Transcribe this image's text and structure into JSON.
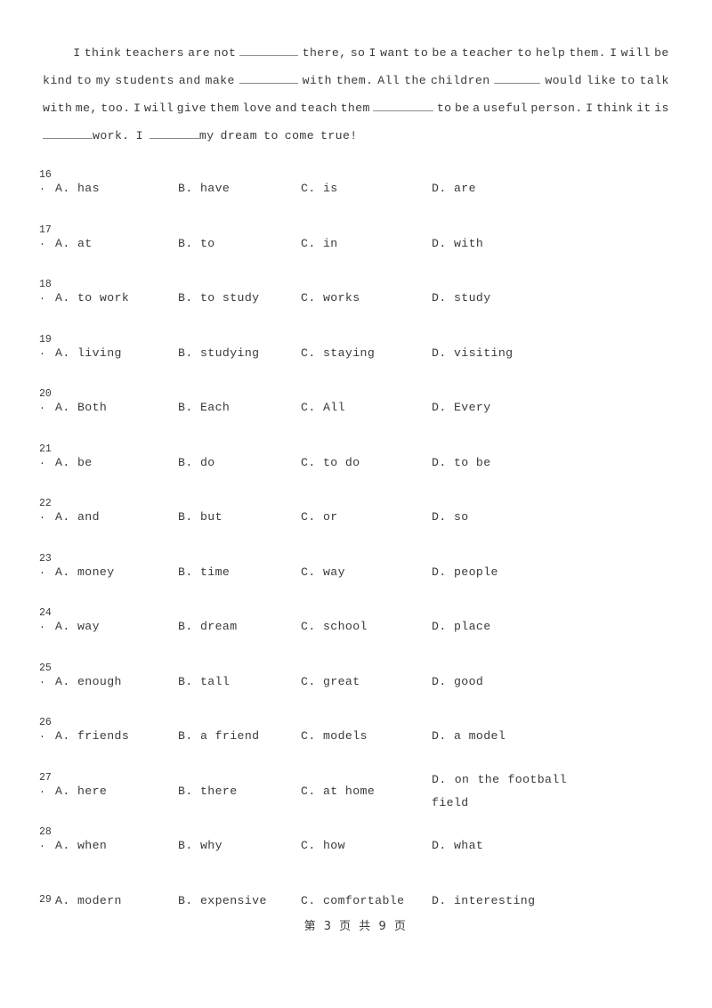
{
  "document": {
    "type": "cloze-test-worksheet",
    "footer": "第 3 页 共 9 页"
  },
  "passage": {
    "lines": [
      {
        "justify": true,
        "tokens": [
          {
            "type": "indent"
          },
          {
            "type": "text",
            "text": "I"
          },
          {
            "type": "text",
            "text": "think"
          },
          {
            "type": "text",
            "text": "teachers"
          },
          {
            "type": "text",
            "text": "are"
          },
          {
            "type": "text",
            "text": "not"
          },
          {
            "type": "blank",
            "size": "b1"
          },
          {
            "type": "text",
            "text": "there,"
          },
          {
            "type": "text",
            "text": "so"
          },
          {
            "type": "text",
            "text": "I"
          },
          {
            "type": "text",
            "text": "want"
          },
          {
            "type": "text",
            "text": "to"
          },
          {
            "type": "text",
            "text": "be"
          },
          {
            "type": "text",
            "text": "a"
          },
          {
            "type": "text",
            "text": "teacher"
          },
          {
            "type": "text",
            "text": "to"
          },
          {
            "type": "text",
            "text": "help"
          },
          {
            "type": "text",
            "text": "them."
          },
          {
            "type": "text",
            "text": "I"
          },
          {
            "type": "text",
            "text": "will"
          },
          {
            "type": "text",
            "text": "be"
          }
        ]
      },
      {
        "justify": true,
        "tokens": [
          {
            "type": "text",
            "text": "kind"
          },
          {
            "type": "text",
            "text": "to"
          },
          {
            "type": "text",
            "text": "my"
          },
          {
            "type": "text",
            "text": "students"
          },
          {
            "type": "text",
            "text": "and"
          },
          {
            "type": "text",
            "text": "make"
          },
          {
            "type": "blank",
            "size": "b2"
          },
          {
            "type": "text",
            "text": "with"
          },
          {
            "type": "text",
            "text": "them."
          },
          {
            "type": "text",
            "text": "All"
          },
          {
            "type": "text",
            "text": "the"
          },
          {
            "type": "text",
            "text": "children"
          },
          {
            "type": "blank",
            "size": "b3"
          },
          {
            "type": "text",
            "text": "would"
          },
          {
            "type": "text",
            "text": "like"
          },
          {
            "type": "text",
            "text": "to"
          },
          {
            "type": "text",
            "text": "talk"
          }
        ]
      },
      {
        "justify": true,
        "tokens": [
          {
            "type": "text",
            "text": "with"
          },
          {
            "type": "text",
            "text": "me,"
          },
          {
            "type": "text",
            "text": "too."
          },
          {
            "type": "text",
            "text": "I"
          },
          {
            "type": "text",
            "text": "will"
          },
          {
            "type": "text",
            "text": "give"
          },
          {
            "type": "text",
            "text": "them"
          },
          {
            "type": "text",
            "text": "love"
          },
          {
            "type": "text",
            "text": "and"
          },
          {
            "type": "text",
            "text": "teach"
          },
          {
            "type": "text",
            "text": "them"
          },
          {
            "type": "blank",
            "size": "b4"
          },
          {
            "type": "text",
            "text": "to"
          },
          {
            "type": "text",
            "text": "be"
          },
          {
            "type": "text",
            "text": "a"
          },
          {
            "type": "text",
            "text": "useful"
          },
          {
            "type": "text",
            "text": "person."
          },
          {
            "type": "text",
            "text": "I"
          },
          {
            "type": "text",
            "text": "think"
          },
          {
            "type": "text",
            "text": "it"
          },
          {
            "type": "text",
            "text": "is"
          }
        ]
      },
      {
        "justify": false,
        "tokens": [
          {
            "type": "blank",
            "size": "b5"
          },
          {
            "type": "text",
            "text": "work."
          },
          {
            "type": "text",
            "text": " I"
          },
          {
            "type": "blank",
            "size": "b6"
          },
          {
            "type": "text",
            "text": "my"
          },
          {
            "type": "text",
            "text": "dream"
          },
          {
            "type": "text",
            "text": "to"
          },
          {
            "type": "text",
            "text": "come"
          },
          {
            "type": "text",
            "text": "true!"
          }
        ]
      }
    ],
    "plain_text": "I think teachers are not ______ there, so I want to be a teacher to help them. I will be kind to my students and make ______ with them. All the children ______ would like to talk with me, too. I will give them love and teach them ______ to be a useful person. I think it is ______ work. I ______ my dream to come true!"
  },
  "questions": [
    {
      "number": "16",
      "dot": ".",
      "options": {
        "a": "A. has",
        "b": "B. have",
        "c": "C. is",
        "d": "D. are"
      }
    },
    {
      "number": "17",
      "dot": ".",
      "options": {
        "a": "A. at",
        "b": "B. to",
        "c": "C. in",
        "d": "D. with"
      }
    },
    {
      "number": "18",
      "dot": ".",
      "options": {
        "a": "A. to work",
        "b": "B. to study",
        "c": "C. works",
        "d": "D. study"
      }
    },
    {
      "number": "19",
      "dot": ".",
      "options": {
        "a": "A. living",
        "b": "B. studying",
        "c": "C. staying",
        "d": "D. visiting"
      }
    },
    {
      "number": "20",
      "dot": ".",
      "options": {
        "a": "A. Both",
        "b": "B. Each",
        "c": "C. All",
        "d": "D. Every"
      }
    },
    {
      "number": "21",
      "dot": ".",
      "options": {
        "a": "A. be",
        "b": "B. do",
        "c": "C. to do",
        "d": "D. to be"
      }
    },
    {
      "number": "22",
      "dot": ".",
      "options": {
        "a": "A. and",
        "b": "B. but",
        "c": "C. or",
        "d": "D. so"
      }
    },
    {
      "number": "23",
      "dot": ".",
      "options": {
        "a": "A. money",
        "b": "B. time",
        "c": "C. way",
        "d": "D. people"
      }
    },
    {
      "number": "24",
      "dot": ".",
      "options": {
        "a": "A. way",
        "b": "B. dream",
        "c": "C. school",
        "d": "D. place"
      }
    },
    {
      "number": "25",
      "dot": ".",
      "options": {
        "a": "A. enough",
        "b": "B. tall",
        "c": "C. great",
        "d": "D. good"
      }
    },
    {
      "number": "26",
      "dot": ".",
      "options": {
        "a": "A. friends",
        "b": "B. a friend",
        "c": "C. models",
        "d": "D. a model"
      }
    },
    {
      "number": "27",
      "dot": ".",
      "wrapped_d": true,
      "options": {
        "a": "A. here",
        "b": "B. there",
        "c": "C. at home",
        "d": "D. on the football field",
        "d_line1_words": [
          "D.",
          "on",
          "the",
          "football"
        ],
        "d_line2": "field"
      }
    },
    {
      "number": "28",
      "dot": ".",
      "options": {
        "a": "A. when",
        "b": "B. why",
        "c": "C. how",
        "d": "D. what"
      }
    },
    {
      "number": "29",
      "dot": "",
      "baseline_number": true,
      "options": {
        "a": "A. modern",
        "b": "B. expensive",
        "c": "C. comfortable",
        "d": "D. interesting"
      }
    }
  ]
}
